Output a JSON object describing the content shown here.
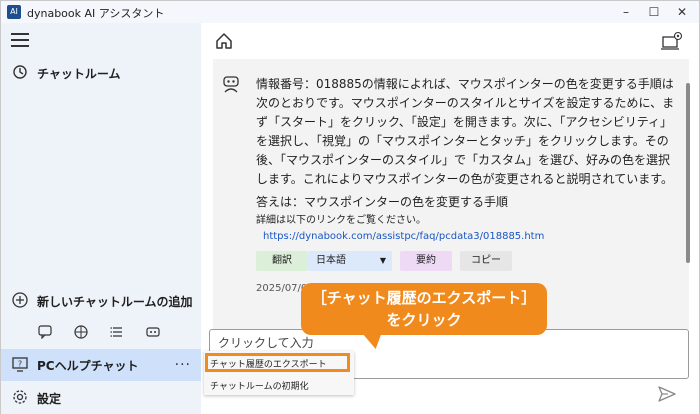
{
  "window": {
    "title": "dynabook AI アシスタント",
    "controls": [
      "–",
      "☐",
      "✕"
    ]
  },
  "sidebar": {
    "menu_icon": "hamburger-icon",
    "chatroom_label": "チャットルーム",
    "add_chatroom_label": "新しいチャットルームの追加",
    "tool_icons": [
      "chat-icon",
      "sports-ball-icon",
      "list-icon",
      "robot-icon"
    ],
    "active_item_label": "PCヘルプチャット",
    "active_item_more": "···",
    "settings_label": "設定"
  },
  "main": {
    "message": {
      "paragraph": "情報番号：018885の情報によれば、マウスポインターの色を変更する手順は次のとおりです。マウスポインターのスタイルとサイズを設定するために、まず「スタート」をクリック、「設定」を開きます。次に、「アクセシビリティ」を選択し、「視覚」の「マウスポインターとタッチ」をクリックします。その後、「マウスポインターのスタイル」で「カスタム」を選び、好みの色を選択します。これによりマウスポインターの色が変更されると説明されています。",
      "answer": "答えは：マウスポインターの色を変更する手順",
      "detail_note": "詳細は以下のリンクをご覧ください。",
      "link": "https://dynabook.com/assistpc/faq/pcdata3/018885.htm",
      "timestamp": "2025/07/04"
    },
    "buttons": {
      "translate": "翻訳",
      "language": "日本語",
      "summary": "要約",
      "copy": "コピー"
    },
    "input": {
      "placeholder": "クリックして入力"
    }
  },
  "context_menu": {
    "export": "チャット履歴のエクスポート",
    "reset": "チャットルームの初期化"
  },
  "callout": {
    "line1": "［チャット履歴のエクスポート］",
    "line2": "をクリック"
  },
  "colors": {
    "sidebar_bg": "#eef2f9",
    "active_item_bg": "#cfe0fb",
    "callout": "#f08a1d",
    "link": "#1a56c2"
  }
}
